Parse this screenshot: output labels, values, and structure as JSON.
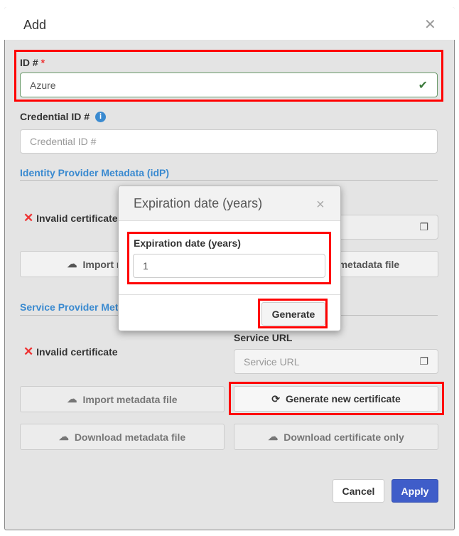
{
  "dialog": {
    "title": "Add",
    "close": "✕"
  },
  "id_field": {
    "label": "ID #",
    "required": "*",
    "value": "Azure",
    "valid_icon": "✔"
  },
  "credential": {
    "label": "Credential ID #",
    "info_icon": "i",
    "placeholder": "Credential ID #"
  },
  "idp": {
    "title": "Identity Provider Metadata (idP)",
    "status": "Invalid certificate",
    "import": "Import metadata file",
    "download": "Download metadata file"
  },
  "sp": {
    "title": "Service Provider Metadata (SP)",
    "status": "Invalid certificate",
    "service_url_label": "Service URL",
    "service_url_placeholder": "Service URL",
    "import": "Import metadata file",
    "generate": "Generate new certificate",
    "download_metadata": "Download metadata file",
    "download_cert": "Download certificate only"
  },
  "footer": {
    "cancel": "Cancel",
    "apply": "Apply"
  },
  "modal": {
    "title": "Expiration date (years)",
    "close": "×",
    "label": "Expiration date (years)",
    "value": "1",
    "generate": "Generate"
  },
  "colors": {
    "accent": "#3f5dc9",
    "highlight": "#ff0000",
    "link": "#3a8ad0",
    "valid": "#3c7a3c"
  }
}
